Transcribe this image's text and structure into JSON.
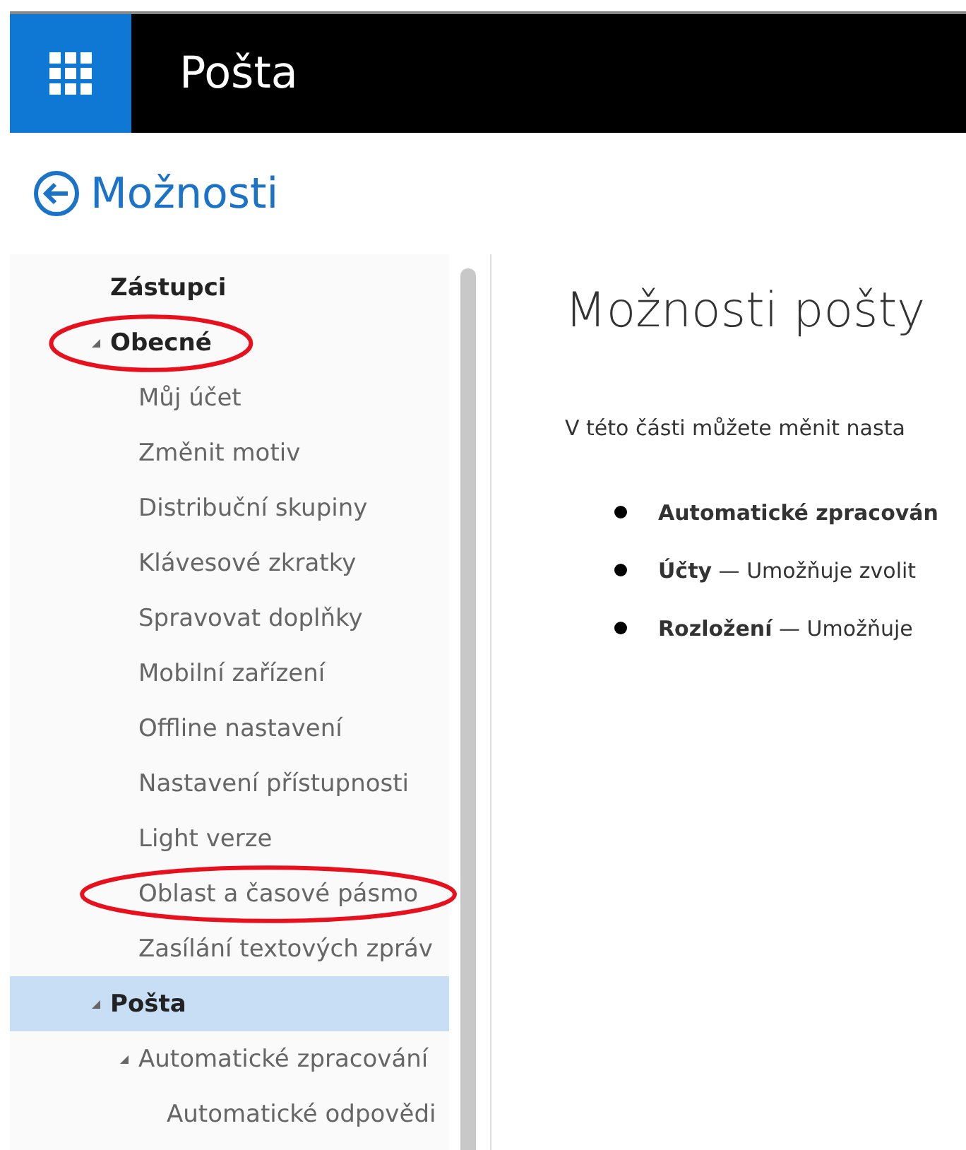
{
  "header": {
    "title": "Pošta"
  },
  "back_link": {
    "label": "Možnosti"
  },
  "sidebar": {
    "items": [
      {
        "label": "Zástupci",
        "selected": false,
        "circled": false
      },
      {
        "label": "Obecné",
        "selected": false,
        "circled": true,
        "expanded": true,
        "children": [
          {
            "label": "Můj účet",
            "selected": false,
            "circled": false
          },
          {
            "label": "Změnit motiv",
            "selected": false,
            "circled": false
          },
          {
            "label": "Distribuční skupiny",
            "selected": false,
            "circled": false
          },
          {
            "label": "Klávesové zkratky",
            "selected": false,
            "circled": false
          },
          {
            "label": "Spravovat doplňky",
            "selected": false,
            "circled": false
          },
          {
            "label": "Mobilní zařízení",
            "selected": false,
            "circled": false
          },
          {
            "label": "Offline nastavení",
            "selected": false,
            "circled": false
          },
          {
            "label": "Nastavení přístupnosti",
            "selected": false,
            "circled": false
          },
          {
            "label": "Light verze",
            "selected": false,
            "circled": false
          },
          {
            "label": "Oblast a časové pásmo",
            "selected": false,
            "circled": true
          },
          {
            "label": "Zasílání textových zpráv",
            "selected": false,
            "circled": false
          }
        ]
      },
      {
        "label": "Pošta",
        "selected": true,
        "circled": false,
        "expanded": true,
        "children": [
          {
            "label": "Automatické zpracování",
            "selected": false,
            "circled": false,
            "expanded": true,
            "children": [
              {
                "label": "Automatické odpovědi",
                "selected": false,
                "circled": false
              }
            ]
          }
        ]
      }
    ]
  },
  "content": {
    "title": "Možnosti pošty",
    "intro": "V této části můžete měnit nasta",
    "bullets": [
      "**Automatické zpracován**",
      "**Účty** — Umožňuje zvolit",
      "**Rozložení** — Umožňuje"
    ]
  }
}
